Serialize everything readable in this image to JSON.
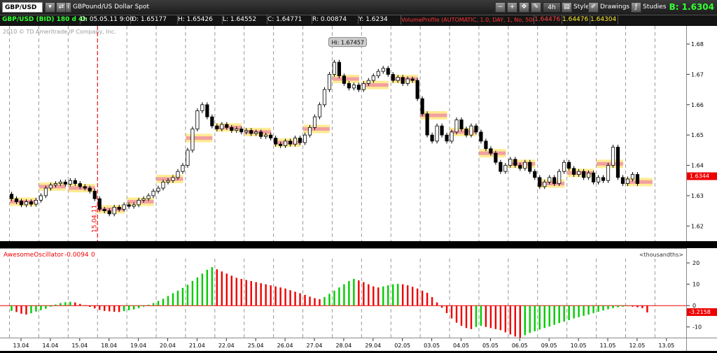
{
  "toolbar": {
    "symbol": "GBP/USD",
    "description": "GBPound/US Dollar Spot",
    "timeframe": "4h",
    "style_label": "Style",
    "drawings_label": "Drawings",
    "studies_label": "Studies",
    "bid": "B: 1.6304"
  },
  "info_bar": {
    "chart_label": "GBP/USD (BID) 180 d 4h",
    "date": "D: 05.05.11 9:00",
    "open": "O: 1.65177",
    "high": "H: 1.65426",
    "low": "L: 1.64552",
    "close": "C: 1.64771",
    "range": "R: 0.00874",
    "y": "Y: 1.6234",
    "volume_profile": "VolumeProfile (AUTOMATIC, 1.0, DAY, 1, No, 500, Yes, Yes, 70, 50)",
    "vp1": "1.64476",
    "vp2": "1.64476",
    "vp3": "1.64304"
  },
  "copyright": "2010 © TD Ameritrade IP Company, Inc.",
  "hi_label": "Hi: 1.67457",
  "cursor_date_label": "15.04.11",
  "last_price_tag": "1.6344",
  "oscillator": {
    "name": "AwesomeOscillator",
    "value": "-0.0094",
    "extra": "0",
    "units": "<thousandths>",
    "current_tag": "-3.2158"
  },
  "colors": {
    "up": "#00cc00",
    "down": "#ee0000",
    "profile_high": "#f2a0a0",
    "profile_mid": "#ffe880",
    "accent_green": "#33ff33"
  },
  "chart_data": {
    "type": "candlestick",
    "price_axis": {
      "min": 1.615,
      "max": 1.686,
      "ticks": [
        "1.68",
        "1.67",
        "1.66",
        "1.65",
        "1.64",
        "1.63",
        "1.62"
      ]
    },
    "x_ticks": [
      "13.04",
      "14.04",
      "15.04",
      "18.04",
      "19.04",
      "20.04",
      "21.04",
      "22.04",
      "25.04",
      "26.04",
      "27.04",
      "28.04",
      "29.04",
      "02.05",
      "03.05",
      "04.05",
      "05.05",
      "06.05",
      "09.05",
      "10.05",
      "11.05",
      "12.05",
      "13.05"
    ],
    "candles_per_day": 6,
    "candles": [
      [
        1.6305,
        1.629
      ],
      [
        1.629,
        1.628
      ],
      [
        1.6282,
        1.627
      ],
      [
        1.627,
        1.628
      ],
      [
        1.628,
        1.6272
      ],
      [
        1.6272,
        1.6285
      ],
      [
        1.6285,
        1.63
      ],
      [
        1.63,
        1.6325
      ],
      [
        1.6325,
        1.6335
      ],
      [
        1.6335,
        1.634
      ],
      [
        1.634,
        1.6345
      ],
      [
        1.6345,
        1.6338
      ],
      [
        1.6338,
        1.635
      ],
      [
        1.635,
        1.634
      ],
      [
        1.634,
        1.633
      ],
      [
        1.633,
        1.6325
      ],
      [
        1.6325,
        1.6315
      ],
      [
        1.6315,
        1.629
      ],
      [
        1.629,
        1.6255
      ],
      [
        1.6255,
        1.625
      ],
      [
        1.625,
        1.624
      ],
      [
        1.624,
        1.6262
      ],
      [
        1.6262,
        1.6255
      ],
      [
        1.6255,
        1.627
      ],
      [
        1.627,
        1.6265
      ],
      [
        1.6265,
        1.627
      ],
      [
        1.627,
        1.6285
      ],
      [
        1.6285,
        1.629
      ],
      [
        1.629,
        1.63
      ],
      [
        1.63,
        1.6315
      ],
      [
        1.6315,
        1.6325
      ],
      [
        1.6325,
        1.6345
      ],
      [
        1.6345,
        1.635
      ],
      [
        1.635,
        1.636
      ],
      [
        1.636,
        1.638
      ],
      [
        1.638,
        1.64
      ],
      [
        1.64,
        1.645
      ],
      [
        1.645,
        1.652
      ],
      [
        1.652,
        1.658
      ],
      [
        1.658,
        1.66
      ],
      [
        1.66,
        1.656
      ],
      [
        1.656,
        1.653
      ],
      [
        1.653,
        1.652
      ],
      [
        1.652,
        1.6535
      ],
      [
        1.6535,
        1.6525
      ],
      [
        1.6525,
        1.6515
      ],
      [
        1.6515,
        1.652
      ],
      [
        1.652,
        1.651
      ],
      [
        1.651,
        1.6515
      ],
      [
        1.6515,
        1.6505
      ],
      [
        1.6505,
        1.651
      ],
      [
        1.651,
        1.6495
      ],
      [
        1.6495,
        1.65
      ],
      [
        1.65,
        1.649
      ],
      [
        1.649,
        1.647
      ],
      [
        1.647,
        1.6465
      ],
      [
        1.6465,
        1.648
      ],
      [
        1.648,
        1.647
      ],
      [
        1.647,
        1.649
      ],
      [
        1.649,
        1.6475
      ],
      [
        1.6475,
        1.65
      ],
      [
        1.65,
        1.6525
      ],
      [
        1.6525,
        1.656
      ],
      [
        1.656,
        1.66
      ],
      [
        1.66,
        1.665
      ],
      [
        1.665,
        1.67
      ],
      [
        1.67,
        1.674
      ],
      [
        1.674,
        1.6695
      ],
      [
        1.6695,
        1.667
      ],
      [
        1.667,
        1.6655
      ],
      [
        1.6655,
        1.6665
      ],
      [
        1.6665,
        1.665
      ],
      [
        1.665,
        1.667
      ],
      [
        1.667,
        1.668
      ],
      [
        1.668,
        1.6695
      ],
      [
        1.6695,
        1.671
      ],
      [
        1.671,
        1.672
      ],
      [
        1.672,
        1.67
      ],
      [
        1.67,
        1.668
      ],
      [
        1.668,
        1.669
      ],
      [
        1.669,
        1.667
      ],
      [
        1.667,
        1.6685
      ],
      [
        1.6685,
        1.668
      ],
      [
        1.668,
        1.662
      ],
      [
        1.662,
        1.657
      ],
      [
        1.657,
        1.65
      ],
      [
        1.65,
        1.648
      ],
      [
        1.648,
        1.653
      ],
      [
        1.653,
        1.65
      ],
      [
        1.65,
        1.648
      ],
      [
        1.648,
        1.651
      ],
      [
        1.651,
        1.655
      ],
      [
        1.655,
        1.652
      ],
      [
        1.652,
        1.65
      ],
      [
        1.65,
        1.653
      ],
      [
        1.653,
        1.651
      ],
      [
        1.651,
        1.648
      ],
      [
        1.648,
        1.6455
      ],
      [
        1.6455,
        1.644
      ],
      [
        1.644,
        1.641
      ],
      [
        1.641,
        1.638
      ],
      [
        1.638,
        1.64
      ],
      [
        1.64,
        1.642
      ],
      [
        1.642,
        1.64
      ],
      [
        1.64,
        1.639
      ],
      [
        1.639,
        1.641
      ],
      [
        1.641,
        1.638
      ],
      [
        1.638,
        1.636
      ],
      [
        1.636,
        1.633
      ],
      [
        1.633,
        1.6345
      ],
      [
        1.6345,
        1.636
      ],
      [
        1.636,
        1.634
      ],
      [
        1.634,
        1.638
      ],
      [
        1.638,
        1.641
      ],
      [
        1.641,
        1.639
      ],
      [
        1.639,
        1.637
      ],
      [
        1.637,
        1.638
      ],
      [
        1.638,
        1.636
      ],
      [
        1.636,
        1.6375
      ],
      [
        1.6375,
        1.6345
      ],
      [
        1.6345,
        1.636
      ],
      [
        1.636,
        1.635
      ],
      [
        1.635,
        1.64
      ],
      [
        1.64,
        1.646
      ],
      [
        1.646,
        1.636
      ],
      [
        1.636,
        1.634
      ],
      [
        1.634,
        1.6355
      ],
      [
        1.6355,
        1.637
      ],
      [
        1.637,
        1.634
      ]
    ],
    "profile_bars": [
      {
        "day": 0,
        "price": 1.628
      },
      {
        "day": 1,
        "price": 1.633
      },
      {
        "day": 2,
        "price": 1.6325
      },
      {
        "day": 3,
        "price": 1.6255
      },
      {
        "day": 4,
        "price": 1.628
      },
      {
        "day": 5,
        "price": 1.6355
      },
      {
        "day": 6,
        "price": 1.649
      },
      {
        "day": 7,
        "price": 1.6525
      },
      {
        "day": 8,
        "price": 1.651
      },
      {
        "day": 9,
        "price": 1.6475
      },
      {
        "day": 10,
        "price": 1.652
      },
      {
        "day": 11,
        "price": 1.6685
      },
      {
        "day": 12,
        "price": 1.6665
      },
      {
        "day": 13,
        "price": 1.6685
      },
      {
        "day": 14,
        "price": 1.6565
      },
      {
        "day": 15,
        "price": 1.651
      },
      {
        "day": 16,
        "price": 1.644
      },
      {
        "day": 17,
        "price": 1.6405
      },
      {
        "day": 18,
        "price": 1.634
      },
      {
        "day": 19,
        "price": 1.6375
      },
      {
        "day": 20,
        "price": 1.6405
      },
      {
        "day": 21,
        "price": 1.6345
      }
    ],
    "oscillator_axis": {
      "min": -15,
      "max": 22,
      "ticks": [
        "20",
        "10",
        "0",
        "-10"
      ]
    },
    "oscillator_values": [
      -2.5,
      -3.0,
      -3.8,
      -4.2,
      -3.6,
      -2.8,
      -2.2,
      -1.5,
      -0.5,
      0.5,
      1.2,
      1.6,
      1.8,
      1.5,
      0.8,
      0.2,
      -0.6,
      -1.3,
      -2.0,
      -2.5,
      -2.7,
      -2.9,
      -3.0,
      -2.6,
      -2.2,
      -1.8,
      -1.2,
      -0.5,
      0.4,
      1.2,
      2.2,
      3.2,
      4.5,
      5.8,
      7.0,
      8.3,
      9.8,
      11.5,
      13.2,
      15.0,
      16.8,
      18.0,
      17.0,
      16.0,
      15.0,
      14.0,
      13.0,
      12.5,
      12.0,
      11.5,
      11.0,
      10.5,
      10.0,
      9.5,
      9.0,
      8.5,
      8.0,
      7.2,
      6.5,
      5.8,
      5.0,
      4.2,
      3.5,
      3.0,
      4.0,
      5.5,
      7.0,
      8.5,
      10.0,
      11.5,
      12.5,
      11.8,
      11.0,
      10.0,
      9.0,
      8.5,
      9.0,
      9.5,
      10.0,
      10.2,
      10.0,
      9.5,
      8.8,
      8.0,
      7.0,
      6.0,
      4.0,
      1.5,
      -1.0,
      -3.5,
      -6.0,
      -8.0,
      -9.5,
      -10.5,
      -11.0,
      -10.0,
      -9.5,
      -10.0,
      -10.5,
      -11.0,
      -11.5,
      -12.5,
      -13.5,
      -14.5,
      -15.0,
      -13.8,
      -12.8,
      -12.0,
      -11.2,
      -10.5,
      -9.8,
      -9.0,
      -8.2,
      -7.5,
      -6.8,
      -6.0,
      -5.4,
      -4.8,
      -4.2,
      -3.5,
      -2.9,
      -2.3,
      -1.7,
      -1.2,
      -0.8,
      -0.5,
      -0.3,
      -0.5,
      -0.8,
      -1.2,
      -3.2
    ]
  }
}
